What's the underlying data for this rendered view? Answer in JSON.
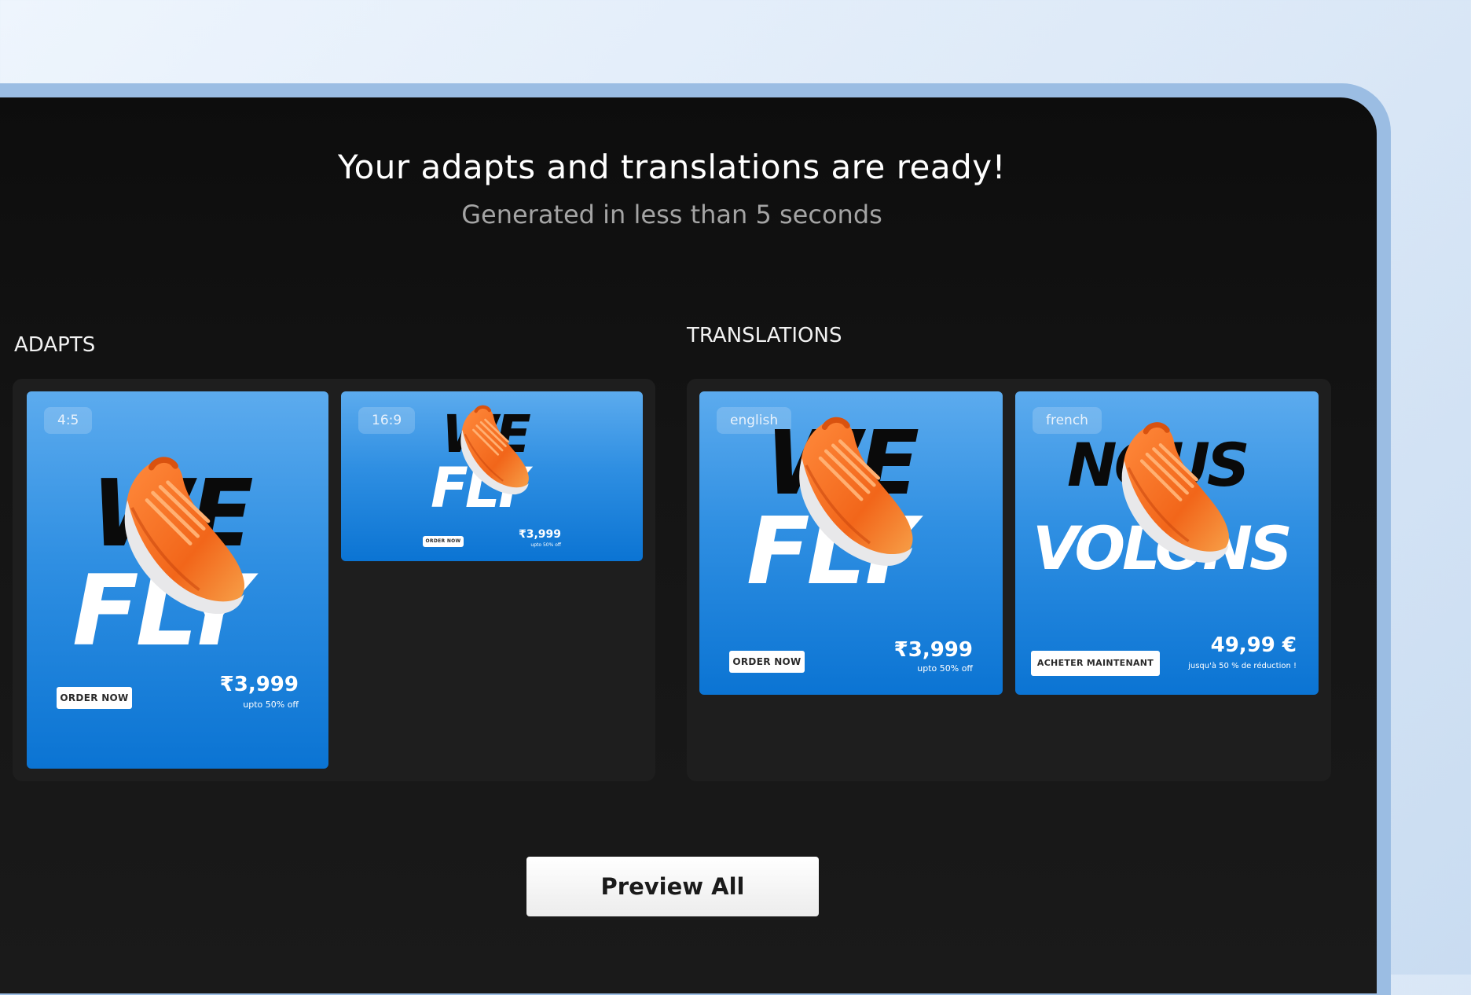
{
  "header": {
    "title": "Your adapts and translations are ready!",
    "subtitle": "Generated in less than 5 seconds"
  },
  "adapts": {
    "label": "ADAPTS",
    "cards": [
      {
        "ratio": "4:5",
        "line1": "WE",
        "line2": "FLY",
        "cta": "ORDER NOW",
        "price": "₹3,999",
        "discount": "upto 50% off"
      },
      {
        "ratio": "16:9",
        "line1": "WE",
        "line2": "FLY",
        "cta": "ORDER NOW",
        "price": "₹3,999",
        "discount": "upto 50% off"
      }
    ]
  },
  "translations": {
    "label": "TRANSLATIONS",
    "cards": [
      {
        "language": "english",
        "line1": "WE",
        "line2": "FLY",
        "cta": "ORDER NOW",
        "price": "₹3,999",
        "discount": "upto 50% off"
      },
      {
        "language": "french",
        "line1": "NOUS",
        "line2": "VOLONS",
        "cta": "ACHETER MAINTENANT",
        "price": "49,99 €",
        "discount": "jusqu'à 50 % de réduction !"
      }
    ]
  },
  "actions": {
    "preview_all": "Preview All"
  },
  "colors": {
    "card_top": "#5cabee",
    "card_bottom": "#0b74d3",
    "shoe": "#f26a1b",
    "frame": "#9bbde3"
  },
  "icons": {
    "product": "sneaker-icon"
  }
}
